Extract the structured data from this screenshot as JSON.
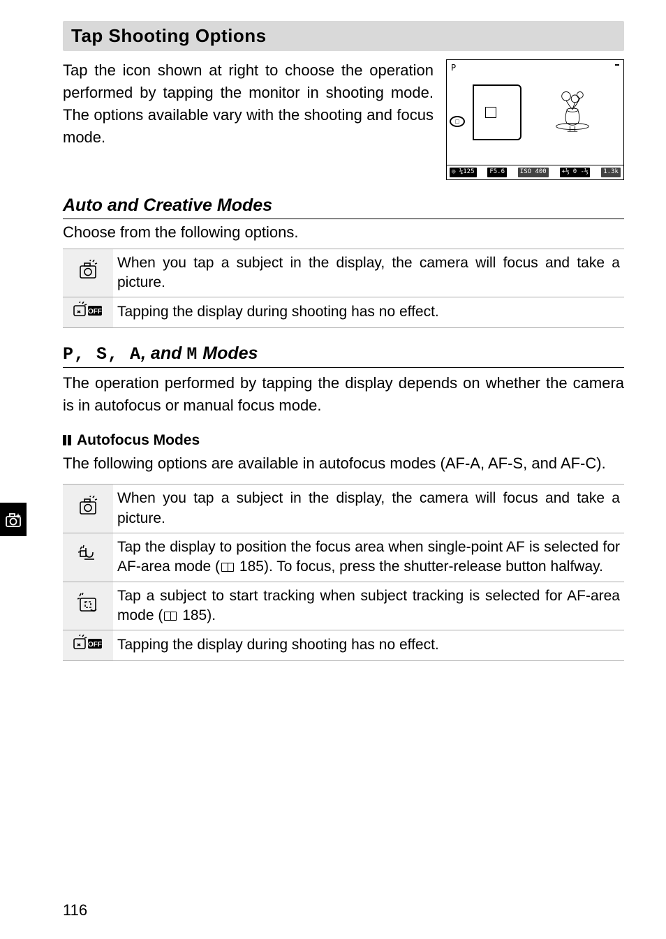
{
  "side_tab": {
    "icon": "camera-sparkle"
  },
  "section_title": "Tap Shooting Options",
  "intro": "Tap the icon shown at right to choose the operation performed by tapping the monitor in shooting mode. The options available vary with the shooting and focus mode.",
  "lcd": {
    "mode_mark": "P",
    "bottom": [
      "◎ ¼125",
      "F5.6",
      "ISO 400",
      "+⅓ 0 -⅓",
      "1.3k"
    ]
  },
  "auto": {
    "heading": "Auto and Creative Modes",
    "sub": "Choose from the following options.",
    "rows": [
      {
        "icon": "tap-shutter",
        "text": "When you tap a subject in the display, the camera will focus and take a picture."
      },
      {
        "icon": "tap-off",
        "text": "Tapping the display during shooting has no effect."
      }
    ]
  },
  "psa": {
    "heading_prefix": "P, S, A",
    "heading_mid": ", and ",
    "heading_m": "M",
    "heading_suffix": " Modes",
    "sub": "The operation performed by tapping the display depends on whether the camera is in autofocus or manual focus mode.",
    "af_heading": "Autofocus Modes",
    "af_sub_a": "The following options are available in autofocus modes (AF-A, AF-S, and AF-C).",
    "rows": [
      {
        "icon": "tap-shutter",
        "text": "When you tap a subject in the display, the camera will focus and take a picture."
      },
      {
        "icon": "tap-af-point",
        "text_a": "Tap the display to position the focus area when single-point AF is selected for AF-area mode (",
        "ref": "185",
        "text_b": "). To focus, press the shutter-release button halfway."
      },
      {
        "icon": "tap-track",
        "text_a": "Tap a subject to start tracking when subject tracking is selected for AF-area mode (",
        "ref": "185",
        "text_b": ")."
      },
      {
        "icon": "tap-off",
        "text": "Tapping the display during shooting has no effect."
      }
    ]
  },
  "page_number": "116"
}
